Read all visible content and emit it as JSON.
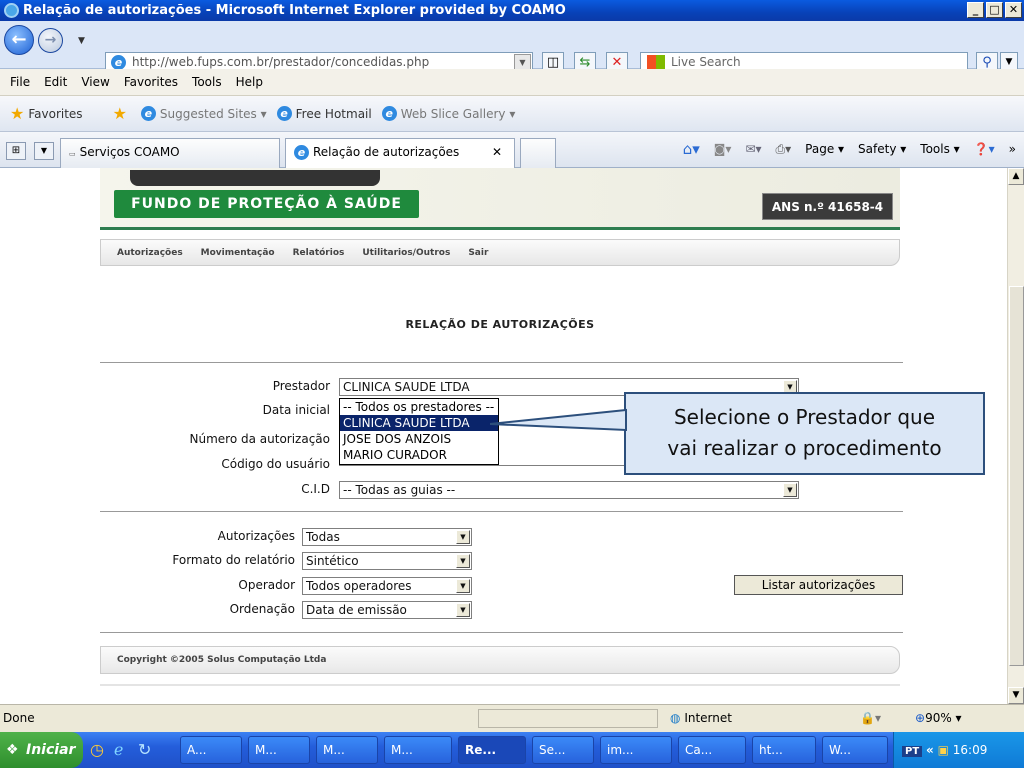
{
  "window": {
    "title": "Relação de autorizações - Microsoft Internet Explorer provided by COAMO"
  },
  "nav": {
    "url": "http://web.fups.com.br/prestador/concedidas.php",
    "search_placeholder": "Live Search"
  },
  "menu": [
    "File",
    "Edit",
    "View",
    "Favorites",
    "Tools",
    "Help"
  ],
  "favorites": {
    "label": "Favorites",
    "items": [
      "Suggested Sites ▾",
      "Free Hotmail",
      "Web Slice Gallery ▾"
    ]
  },
  "tabs": [
    {
      "label": "Serviços COAMO"
    },
    {
      "label": "Relação de autorizações"
    }
  ],
  "commands": [
    "Page ▾",
    "Safety ▾",
    "Tools ▾"
  ],
  "page": {
    "logo_text": "FUNDO DE PROTEÇÃO À SAÚDE",
    "ans": "ANS n.º 41658-4",
    "menu": [
      "Autorizações",
      "Movimentação",
      "Relatórios",
      "Utilitarios/Outros",
      "Sair"
    ],
    "title": "RELAÇÃO DE AUTORIZAÇÕES",
    "fields": {
      "prestador_label": "Prestador",
      "prestador_value": "CLINICA SAUDE LTDA",
      "data_inicial_label": "Data inicial",
      "numero_label": "Número da autorização",
      "codigo_label": "Código do usuário",
      "cid_label": "C.I.D",
      "cid_value": "-- Todas as guias --"
    },
    "dropdown_options": [
      "-- Todos os prestadores --",
      "CLINICA SAUDE LTDA",
      "JOSE DOS ANZOIS",
      "MARIO CURADOR"
    ],
    "dropdown_selected": 1,
    "options": {
      "autorizacoes_label": "Autorizações",
      "autorizacoes_value": "Todas",
      "formato_label": "Formato do relatório",
      "formato_value": "Sintético",
      "operador_label": "Operador",
      "operador_value": "Todos operadores",
      "ordenacao_label": "Ordenação",
      "ordenacao_value": "Data de emissão"
    },
    "list_button": "Listar autorizações",
    "footer": "Copyright ©2005 Solus Computação Ltda"
  },
  "callout": {
    "line1": "Selecione o Prestador que",
    "line2": "vai realizar o procedimento"
  },
  "status": {
    "left": "Done",
    "zone": "Internet",
    "zoom": "90%"
  },
  "taskbar": {
    "start": "Iniciar",
    "tasks": [
      "A...",
      "M...",
      "M...",
      "M...",
      "Re...",
      "Se...",
      "im...",
      "Ca...",
      "ht...",
      "W..."
    ],
    "clock": "16:09"
  }
}
